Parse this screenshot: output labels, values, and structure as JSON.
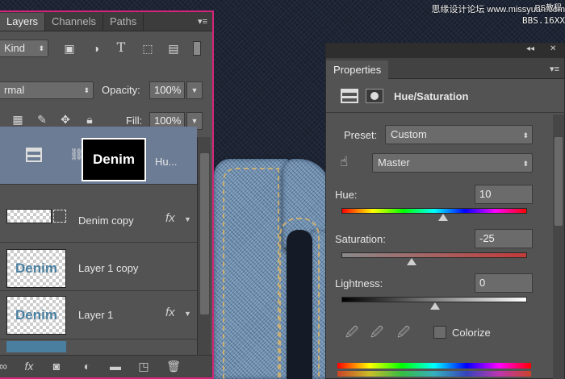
{
  "watermark": {
    "line1": "思缘设计论坛 www.missyuan.com",
    "line2": "PS教程",
    "line3": "BBS.16XX"
  },
  "layers_panel": {
    "tabs": [
      "Layers",
      "Channels",
      "Paths"
    ],
    "filter_kind": "Kind",
    "blend_mode": "rmal",
    "opacity_label": "Opacity:",
    "opacity_value": "100%",
    "fill_label": "Fill:",
    "fill_value": "100%",
    "layers": [
      {
        "name": "Hu...",
        "mask_text": "Denim",
        "selected": true
      },
      {
        "name": "Denim copy",
        "fx": "fx"
      },
      {
        "name": "Layer 1 copy",
        "thumb_text": "Denim"
      },
      {
        "name": "Layer 1",
        "thumb_text": "Denim",
        "fx": "fx"
      }
    ],
    "footer_fx": "fx"
  },
  "properties_panel": {
    "collapse_glyph": "◂◂",
    "close_glyph": "✕",
    "tab": "Properties",
    "title": "Hue/Saturation",
    "preset_label": "Preset:",
    "preset_value": "Custom",
    "channel_value": "Master",
    "hue_label": "Hue:",
    "hue_value": "10",
    "saturation_label": "Saturation:",
    "saturation_value": "-25",
    "lightness_label": "Lightness:",
    "lightness_value": "0",
    "colorize_label": "Colorize"
  },
  "colors": {
    "highlight_border": "#d4257a",
    "selected_layer": "#6c7c95",
    "panel_bg": "#535353"
  }
}
